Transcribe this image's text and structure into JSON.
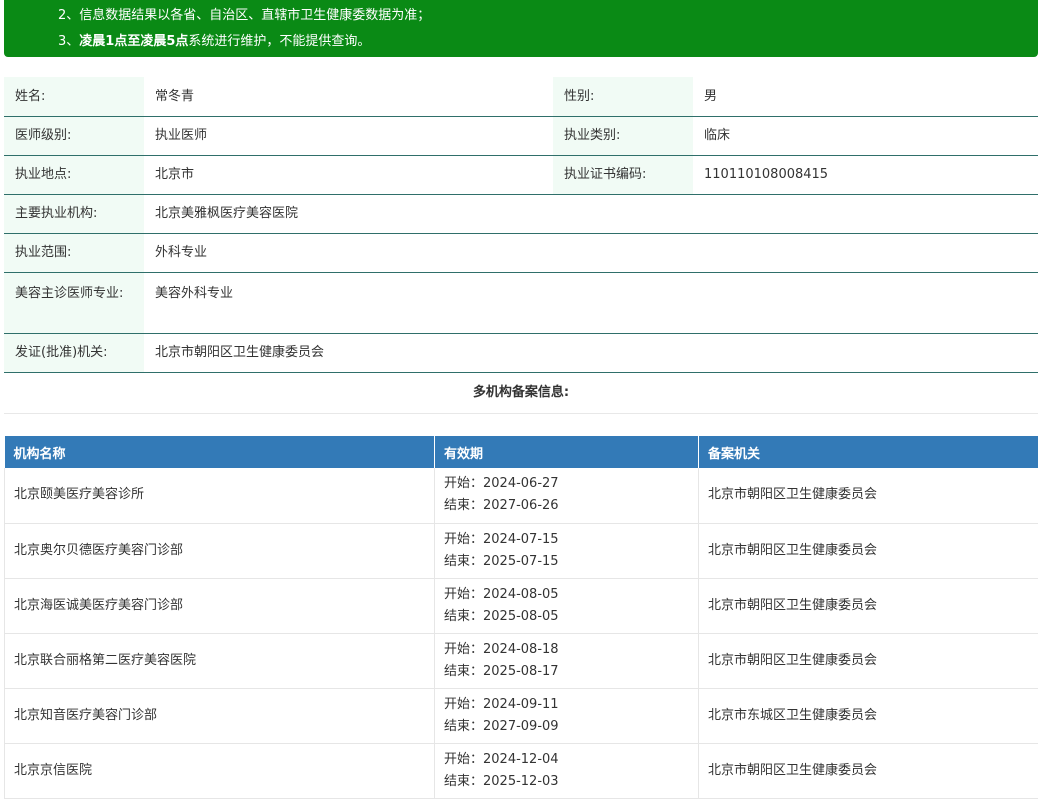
{
  "notice": {
    "line2": "2、信息数据结果以各省、自治区、直辖市卫生健康委数据为准；",
    "line3_prefix": "3、",
    "line3_bold": "凌晨1点至凌晨5点",
    "line3_rest": "系统进行维护，不能提供查询。"
  },
  "info": {
    "name_label": "姓名:",
    "name_value": "常冬青",
    "gender_label": "性别:",
    "gender_value": "男",
    "level_label": "医师级别:",
    "level_value": "执业医师",
    "category_label": "执业类别:",
    "category_value": "临床",
    "location_label": "执业地点:",
    "location_value": "北京市",
    "cert_label": "执业证书编码:",
    "cert_value": "110110108008415",
    "institution_label": "主要执业机构:",
    "institution_value": "北京美雅枫医疗美容医院",
    "scope_label": "执业范围:",
    "scope_value": "外科专业",
    "specialty_label": "美容主诊医师专业:",
    "specialty_value": "美容外科专业",
    "issuer_label": "发证(批准)机关:",
    "issuer_value": "北京市朝阳区卫生健康委员会"
  },
  "multi_title": "多机构备案信息:",
  "records": {
    "headers": [
      "机构名称",
      "有效期",
      "备案机关"
    ],
    "start_prefix": "开始：",
    "end_prefix": "结束：",
    "rows": [
      {
        "org": "北京颐美医疗美容诊所",
        "start": "2024-06-27",
        "end": "2027-06-26",
        "authority": "北京市朝阳区卫生健康委员会"
      },
      {
        "org": "北京奥尔贝德医疗美容门诊部",
        "start": "2024-07-15",
        "end": "2025-07-15",
        "authority": "北京市朝阳区卫生健康委员会"
      },
      {
        "org": "北京海医诚美医疗美容门诊部",
        "start": "2024-08-05",
        "end": "2025-08-05",
        "authority": "北京市朝阳区卫生健康委员会"
      },
      {
        "org": "北京联合丽格第二医疗美容医院",
        "start": "2024-08-18",
        "end": "2025-08-17",
        "authority": "北京市朝阳区卫生健康委员会"
      },
      {
        "org": "北京知音医疗美容门诊部",
        "start": "2024-09-11",
        "end": "2027-09-09",
        "authority": "北京市东城区卫生健康委员会"
      },
      {
        "org": "北京京信医院",
        "start": "2024-12-04",
        "end": "2025-12-03",
        "authority": "北京市朝阳区卫生健康委员会"
      }
    ]
  }
}
